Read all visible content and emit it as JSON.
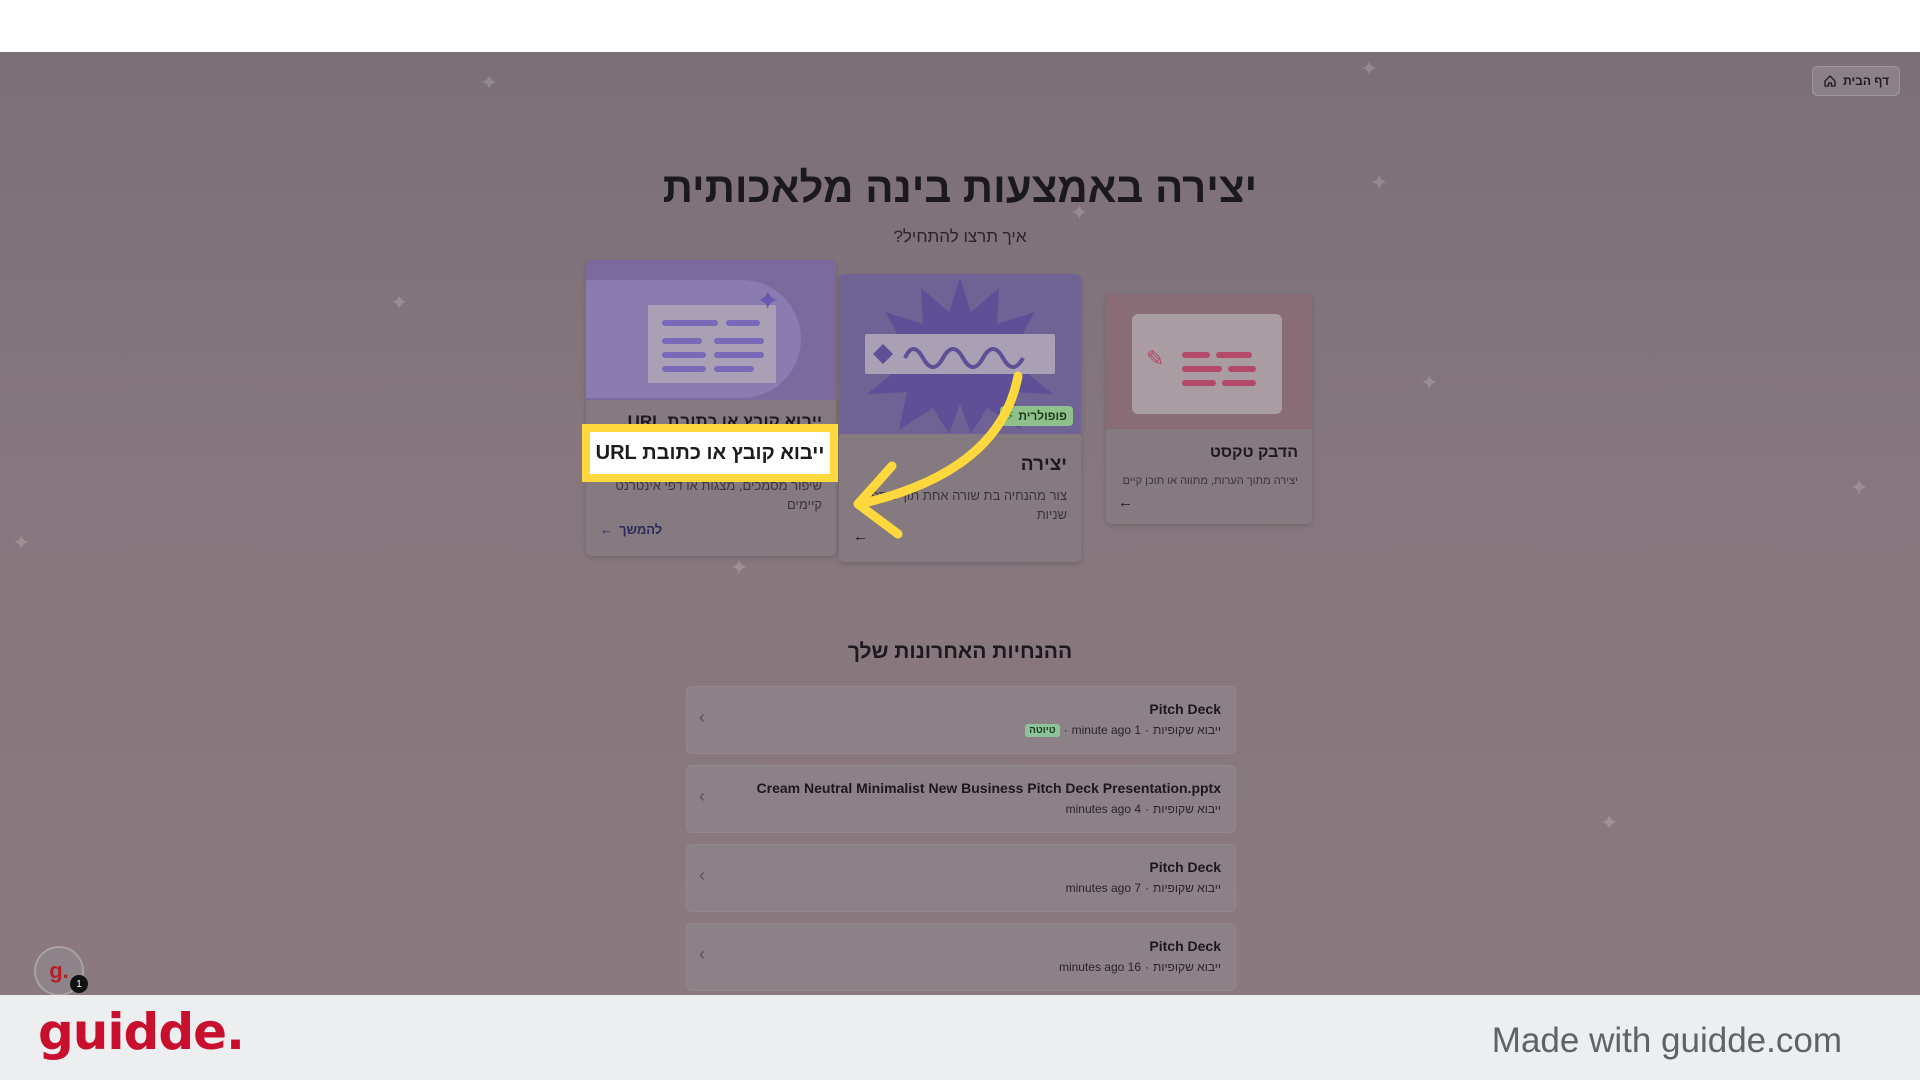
{
  "header": {
    "home_label": "דף הבית"
  },
  "hero": {
    "title": "יצירה באמצעות בינה מלאכותית",
    "subtitle": "איך תרצו להתחיל?"
  },
  "cards": [
    {
      "title": "ייבוא קובץ או כתובת URL",
      "description": "שיפור מסמכים, מצגות או דפי אינטרנט קיימים",
      "action": "להמשך"
    },
    {
      "title": "יצירה",
      "description": "צור מהנחיה בת שורה אחת תוך מספר שניות",
      "badge": "פופולרית"
    },
    {
      "title": "הדבק טקסט",
      "description": "יצירה מתוך הערות, מתווה או תוכן קיים"
    }
  ],
  "callout": {
    "label": "ייבוא קובץ או כתובת URL",
    "accent": "#ffd83d"
  },
  "recent": {
    "title": "ההנחיות האחרונות שלך",
    "items": [
      {
        "name": "Pitch Deck",
        "type": "ייבוא שקופיות",
        "time": "1 minute ago",
        "tag": "טיוטה"
      },
      {
        "name": "Cream Neutral Minimalist New Business Pitch Deck Presentation.pptx",
        "type": "ייבוא שקופיות",
        "time": "4 minutes ago"
      },
      {
        "name": "Pitch Deck",
        "type": "ייבוא שקופיות",
        "time": "7 minutes ago"
      },
      {
        "name": "Pitch Deck",
        "type": "ייבוא שקופיות",
        "time": "16 minutes ago"
      }
    ]
  },
  "widget": {
    "letter": "g.",
    "badge": "1"
  },
  "footer": {
    "brand": "guidde.",
    "made_with": "Made with guidde.com",
    "brand_color": "#c8102e"
  }
}
